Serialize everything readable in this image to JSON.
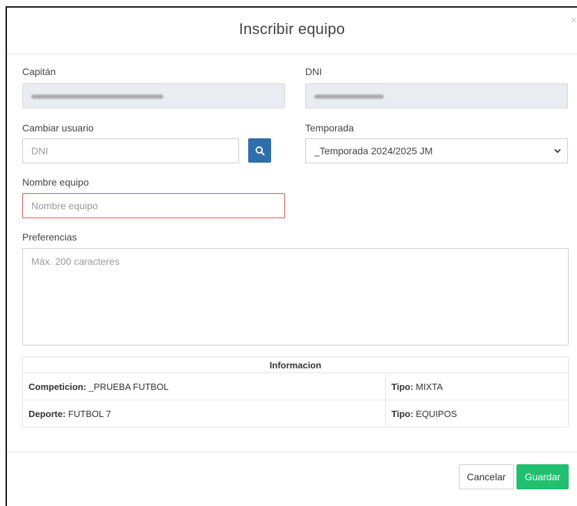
{
  "modal": {
    "title": "Inscribir equipo",
    "close_glyph": "×"
  },
  "form": {
    "captain_label": "Capitán",
    "dni_label": "DNI",
    "change_user_label": "Cambiar usuario",
    "change_user_placeholder": "DNI",
    "season_label": "Temporada",
    "season_value": "_Temporada 2024/2025 JM",
    "team_name_label": "Nombre equipo",
    "team_name_placeholder": "Nombre equipo",
    "preferences_label": "Preferencias",
    "preferences_placeholder": "Máx. 200 caracteres"
  },
  "info": {
    "header": "Informacion",
    "rows": [
      {
        "left_key": "Competicion:",
        "left_value": " _PRUEBA FUTBOL",
        "right_key": "Tipo:",
        "right_value": " MIXTA"
      },
      {
        "left_key": "Deporte:",
        "left_value": " FUTBOL 7",
        "right_key": "Tipo:",
        "right_value": " EQUIPOS"
      }
    ]
  },
  "footer": {
    "cancel_label": "Cancelar",
    "save_label": "Guardar"
  },
  "colors": {
    "primary": "#2f6ea8",
    "success": "#20c070",
    "error_border": "#d9534f",
    "disabled_bg": "#e9edf2"
  },
  "icons": {
    "search": "search-icon",
    "select": "chevron-down-icon",
    "close": "close-icon"
  }
}
